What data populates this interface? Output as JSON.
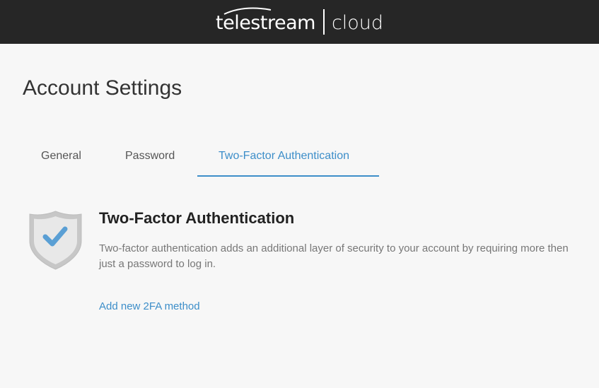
{
  "header": {
    "brand": "telestream",
    "product": "cloud"
  },
  "page": {
    "title": "Account Settings"
  },
  "tabs": [
    {
      "label": "General",
      "active": false
    },
    {
      "label": "Password",
      "active": false
    },
    {
      "label": "Two-Factor Authentication",
      "active": true
    }
  ],
  "two_factor": {
    "icon": "shield-check-icon",
    "title": "Two-Factor Authentication",
    "description": "Two-factor authentication adds an additional layer of security to your account by requiring more then just a password to log in.",
    "add_link": "Add new 2FA method"
  },
  "colors": {
    "header_bg": "#262626",
    "page_bg": "#f7f7f7",
    "accent": "#3d8ec9",
    "check": "#5a9fd4"
  }
}
